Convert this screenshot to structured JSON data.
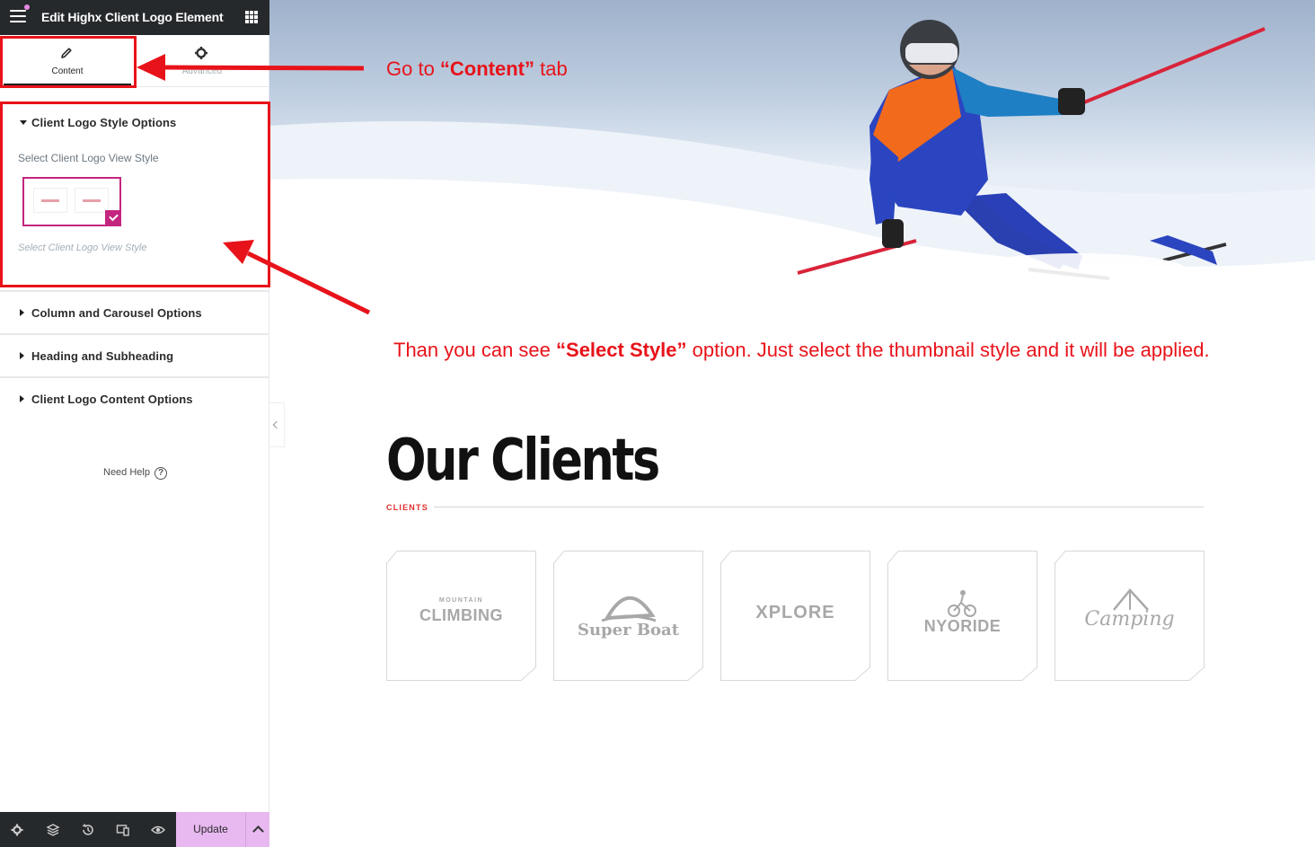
{
  "editor": {
    "title": "Edit Highx Client Logo Element",
    "tabs": [
      {
        "label": "Content",
        "icon": "pencil-icon"
      },
      {
        "label": "Advanced",
        "icon": "gear-icon"
      }
    ],
    "sections": [
      {
        "label": "Client Logo Style Options",
        "expanded": true
      },
      {
        "label": "Column and Carousel Options",
        "expanded": false
      },
      {
        "label": "Heading and Subheading",
        "expanded": false
      },
      {
        "label": "Client Logo Content Options",
        "expanded": false
      }
    ],
    "style_field": {
      "label": "Select Client Logo View Style",
      "description": "Select Client Logo View Style"
    },
    "need_help": "Need Help",
    "update_label": "Update",
    "bottom_icons": [
      "settings-icon",
      "layers-icon",
      "history-icon",
      "responsive-icon",
      "preview-icon"
    ]
  },
  "annotations": {
    "content_tab": {
      "pre": "Go  to ",
      "bold": "“Content”",
      "post": " tab"
    },
    "select_style": {
      "pre": "Than you can see ",
      "bold": "“Select Style”",
      "post": " option. Just select the thumbnail style and it will be applied."
    }
  },
  "preview": {
    "heading": "Our Clients",
    "subheading": "CLIENTS",
    "logos": [
      {
        "small": "MOUNTAIN",
        "name": "CLIMBING"
      },
      {
        "name": "Super Boat"
      },
      {
        "name": "XPLORE"
      },
      {
        "name": "NYORIDE"
      },
      {
        "name": "Camping"
      }
    ]
  },
  "colors": {
    "accent": "#c4257f",
    "annotation": "#e8131a",
    "topbar": "#26292c",
    "update_button": "#e8b8f0"
  }
}
